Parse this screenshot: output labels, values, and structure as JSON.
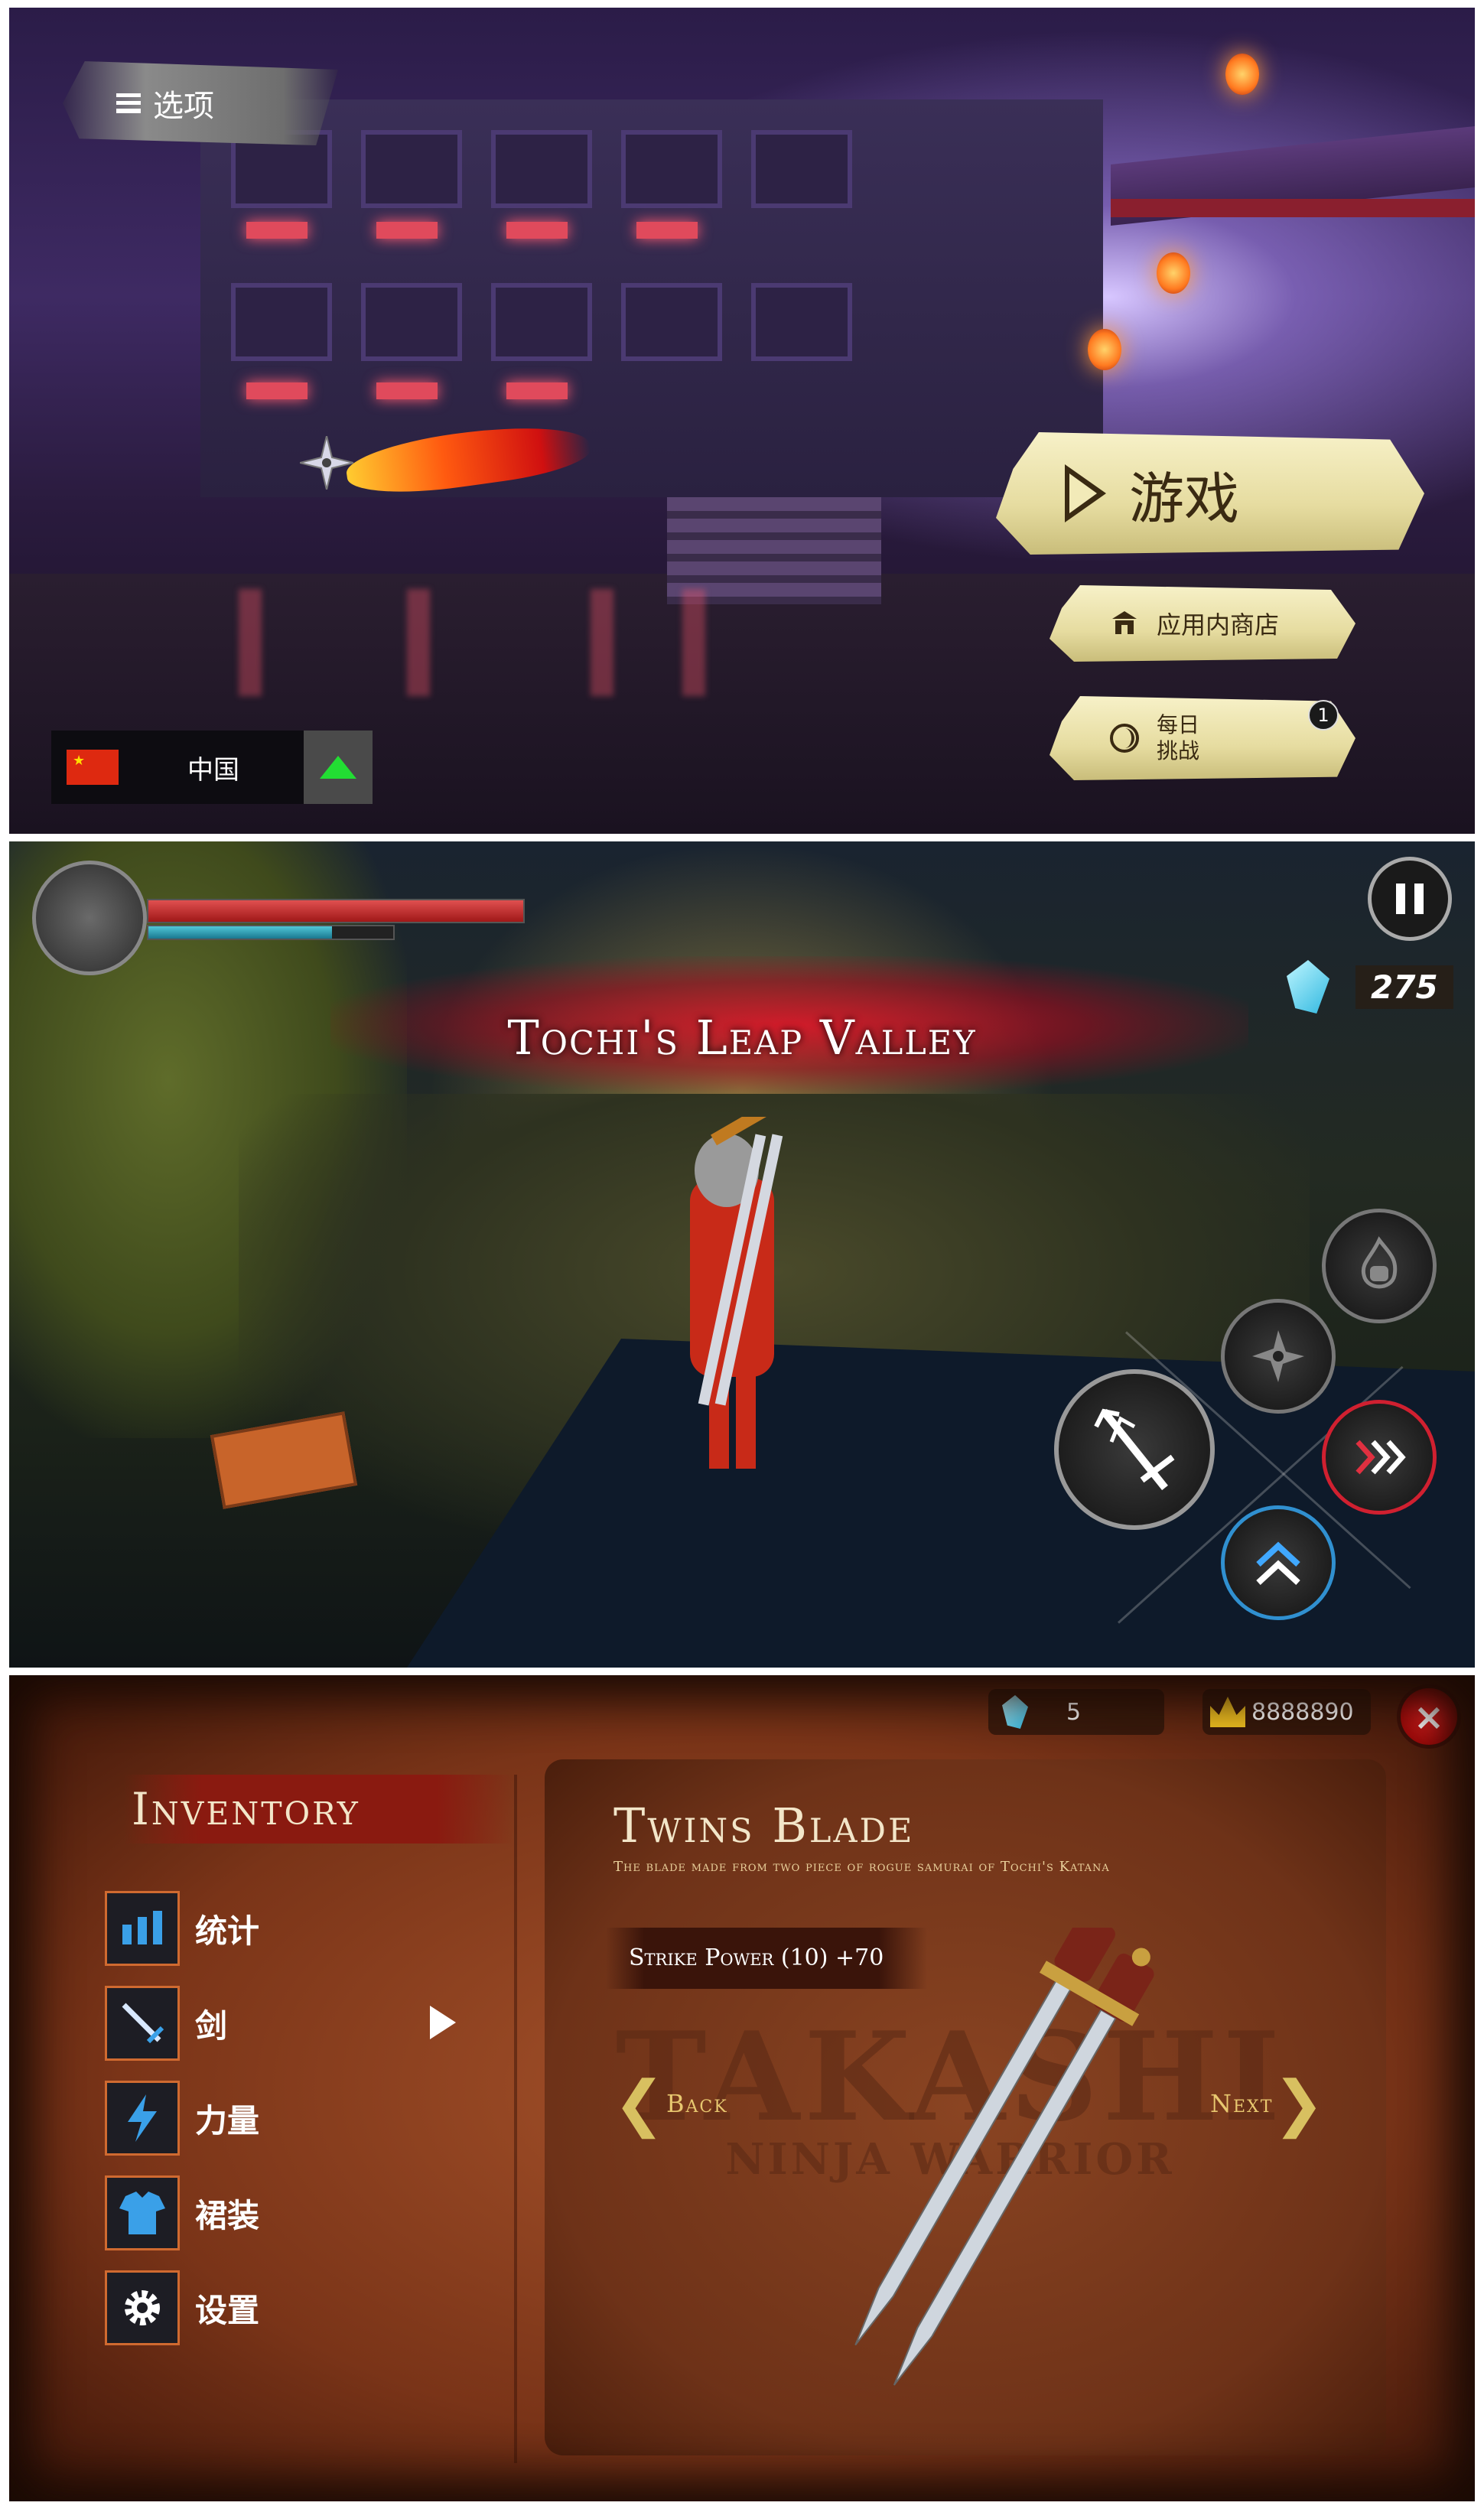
{
  "title_screen": {
    "options_label": "选项",
    "play_label": "游戏",
    "store_label": "应用内商店",
    "daily_label": "每日\n挑战",
    "daily_badge": "1",
    "region_name": "中国",
    "flag_icon": "china-flag-icon",
    "region_toggle_icon": "triangle-up-icon"
  },
  "gameplay": {
    "zone_title": "Tochi's Leap Valley",
    "health": 1.0,
    "energy": 0.75,
    "gem_count": "275",
    "icons": {
      "pause": "pause-icon",
      "gem": "crystal-gem-icon",
      "skill_fire": "fire-fist-icon",
      "skill_shuriken": "shuriken-icon",
      "skill_attack": "sword-attack-icon",
      "skill_dash": "dash-chevrons-icon",
      "skill_jump": "jump-chevrons-icon"
    },
    "colors": {
      "health": "#c02020",
      "energy": "#30a8c0",
      "dash_ring": "#d02030",
      "jump_ring": "#3090d0"
    }
  },
  "inventory": {
    "title": "Inventory",
    "gems": "5",
    "gold": "8888890",
    "menu": [
      {
        "label": "统计",
        "icon": "stats-bars-icon"
      },
      {
        "label": "剑",
        "icon": "sword-icon"
      },
      {
        "label": "力量",
        "icon": "lightning-icon"
      },
      {
        "label": "裙装",
        "icon": "armor-icon"
      },
      {
        "label": "设置",
        "icon": "gear-icon"
      }
    ],
    "selected_index": 1,
    "item": {
      "name": "Twins Blade",
      "description": "The blade made from two piece of rogue samurai of Tochi's Katana",
      "stat": "Strike Power (10) +70"
    },
    "back_label": "Back",
    "next_label": "Next",
    "watermark_big": "TAKASHI",
    "watermark_small": "NINJA WARRIOR"
  }
}
